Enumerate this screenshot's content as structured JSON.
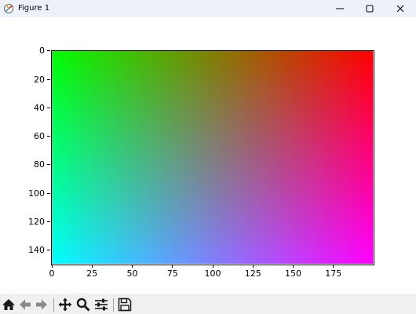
{
  "window": {
    "title": "Figure 1",
    "app_icon": "matplotlib-figure-icon",
    "controls": [
      "minimize-icon",
      "maximize-icon",
      "close-icon"
    ]
  },
  "toolbar": {
    "buttons": [
      "home-icon",
      "back-arrow-icon",
      "forward-arrow-icon",
      "pan-icon",
      "zoom-icon",
      "configure-subplots-icon",
      "save-icon"
    ],
    "enabled": [
      true,
      false,
      false,
      true,
      true,
      true,
      true
    ]
  },
  "chart_data": {
    "type": "heatmap",
    "title": "",
    "xlabel": "",
    "ylabel": "",
    "x_ticks": [
      "0",
      "25",
      "50",
      "75",
      "100",
      "125",
      "150",
      "175"
    ],
    "y_ticks": [
      "0",
      "20",
      "40",
      "60",
      "80",
      "100",
      "120",
      "140"
    ],
    "xlim": [
      0,
      199
    ],
    "ylim": [
      149,
      0
    ],
    "image_size": [
      200,
      150
    ],
    "corner_colors": {
      "top_left": "#00ff00",
      "top_right": "#ff0000",
      "bottom_left": "#00ffff",
      "bottom_right": "#ff00ff"
    },
    "grid": false
  }
}
